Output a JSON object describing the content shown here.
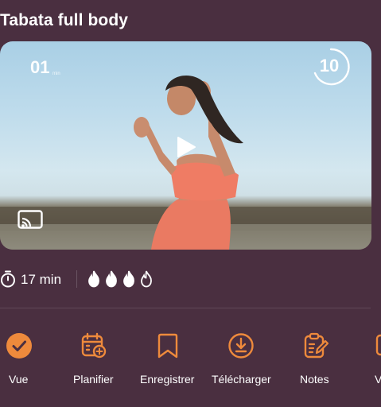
{
  "page": {
    "title": "Tabata full body"
  },
  "video": {
    "timer_minutes": "01",
    "timer_unit": "min",
    "round_number": "10",
    "play_icon": "play-icon",
    "cast_icon": "cast-icon"
  },
  "meta": {
    "duration": "17 min",
    "intensity_filled": 3,
    "intensity_total": 4
  },
  "actions": [
    {
      "label": "Vue",
      "icon": "check-circle-icon"
    },
    {
      "label": "Planifier",
      "icon": "calendar-add-icon"
    },
    {
      "label": "Enregistrer",
      "icon": "bookmark-icon"
    },
    {
      "label": "Télécharger",
      "icon": "download-icon"
    },
    {
      "label": "Notes",
      "icon": "notes-edit-icon"
    },
    {
      "label": "V",
      "icon": "partial-icon"
    }
  ],
  "colors": {
    "background": "#4a2f40",
    "accent": "#ee8a3c",
    "text": "#ffffff"
  }
}
